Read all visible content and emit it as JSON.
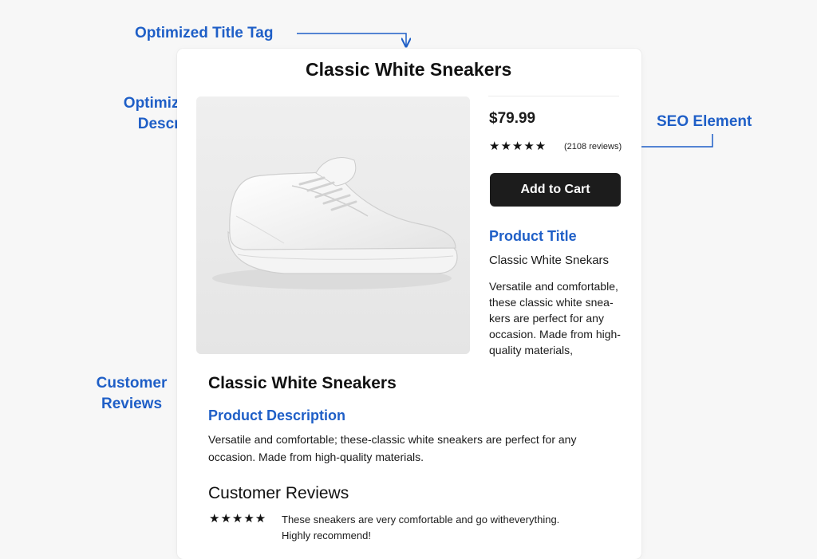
{
  "annotations": {
    "title_tag": "Optimized Title Tag",
    "meta_description_line1": "Optimized Meta",
    "meta_description_line2": "Description",
    "seo_element": "SEO Element",
    "customer_reviews_line1": "Customer",
    "customer_reviews_line2": "Reviews"
  },
  "page": {
    "title": "Classic White Sneakers"
  },
  "product": {
    "price": "$79.99",
    "rating_stars": "★★★★★",
    "review_count": "(2108 reviews)",
    "add_to_cart_label": "Add to Cart",
    "title_heading": "Product Title",
    "title_value": "Classic White Snekars",
    "short_description": "Versatile and comfortable, these classic white snea-kers are perfect for any occasion. Made from high-quality materials,"
  },
  "main": {
    "heading": "Classic White Sneakers",
    "description_heading": "Product Description",
    "description_text": "Versatile and comfortable; these-classic white sneakers are perfect for any occasion. Made from high-quality materials."
  },
  "reviews": {
    "heading": "Customer Reviews",
    "items": [
      {
        "stars": "★★★★★",
        "text": "These sneakers are very comfortable and go witheverything. Highly recommend!"
      }
    ]
  },
  "colors": {
    "annotation_blue": "#1f5fc7",
    "button_bg": "#1c1c1c",
    "page_bg": "#f7f7f7",
    "card_bg": "#ffffff"
  }
}
